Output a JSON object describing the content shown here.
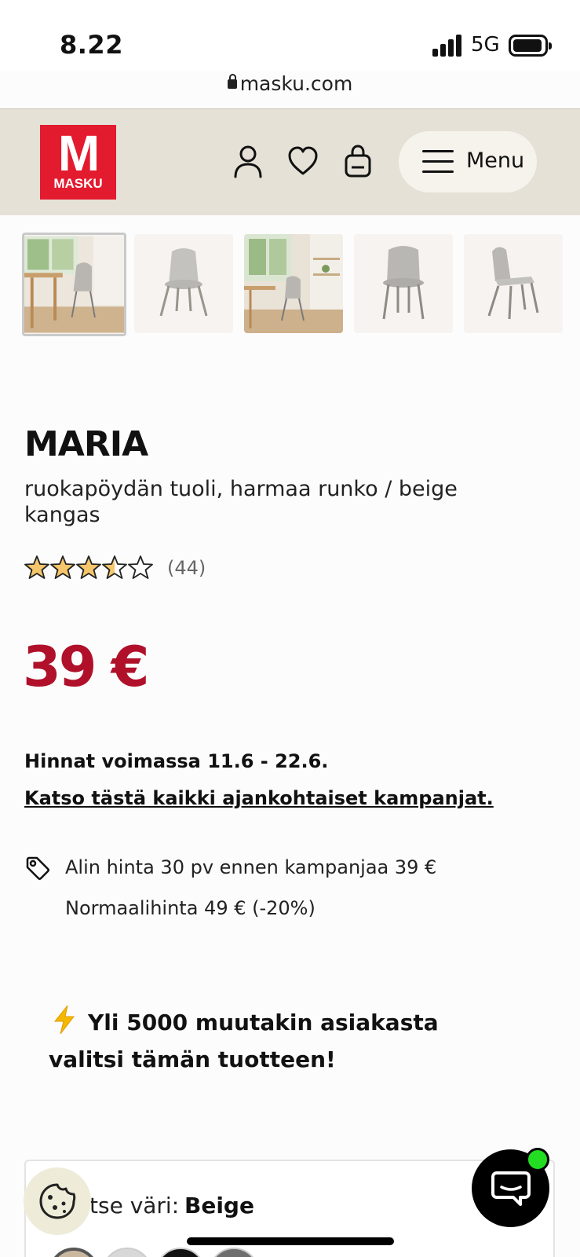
{
  "status_bar": {
    "time": "8.22",
    "network": "5G"
  },
  "browser": {
    "url": "masku.com"
  },
  "header": {
    "logo_text": "MASKU",
    "menu_label": "Menu"
  },
  "gallery": {
    "thumbnails": [
      {
        "label": "room-scene-1"
      },
      {
        "label": "chair-front"
      },
      {
        "label": "room-scene-2"
      },
      {
        "label": "chair-front-2"
      },
      {
        "label": "chair-angle"
      }
    ]
  },
  "product": {
    "name": "MARIA",
    "description": "ruokapöydän tuoli, harmaa runko / beige kangas",
    "rating": 3.5,
    "rating_max": 5,
    "review_count": "(44)",
    "price": "39 €",
    "price_color": "#b0102a"
  },
  "campaign": {
    "valid_text": "Hinnat voimassa 11.6 - 22.6.",
    "link_text": "Katso tästä kaikki ajankohtaiset kampanjat."
  },
  "price_info": {
    "lowest": "Alin hinta 30 pv ennen kampanjaa 39 €",
    "normal": "Normaalihinta 49 € (-20%)"
  },
  "social_proof": {
    "text": "Yli 5000 muutakin asiakasta valitsi tämän tuotteen!"
  },
  "color_selector": {
    "label": "tse väri:",
    "selected": "Beige",
    "swatches": [
      "#c9b7a0",
      "#d8d8d8",
      "#111111",
      "#6e6e6e"
    ]
  },
  "colors": {
    "brand_red": "#e31b2f",
    "header_bg": "#e5e1d7",
    "star_fill": "#f5c66b"
  }
}
